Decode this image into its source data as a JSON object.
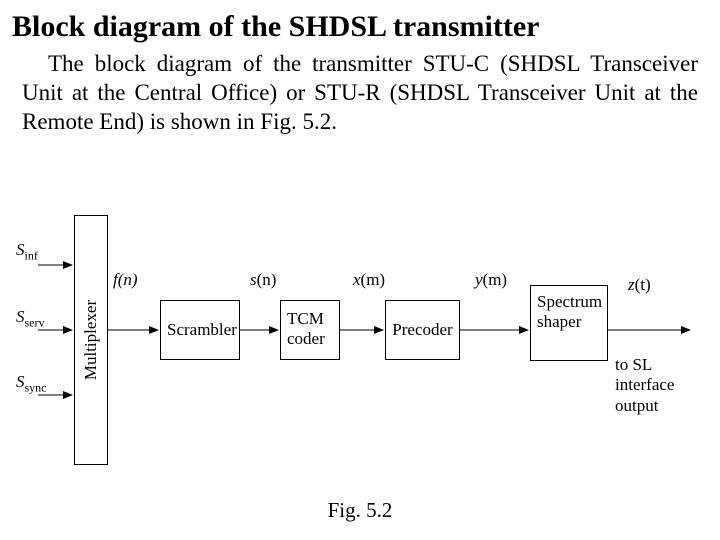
{
  "title": "Block diagram of the SHDSL transmitter",
  "paragraph": "The block diagram of the transmitter STU-C (SHDSL Transceiver Unit at the Central Office) or STU-R (SHDSL Transceiver Unit at the Remote End) is shown in Fig. 5.2.",
  "blocks": {
    "multiplexer": "Multiplexer",
    "scrambler": "Scrambler",
    "tcm_coder": "TCM coder",
    "precoder": "Precoder",
    "spectrum_shaper": "Spectrum shaper"
  },
  "inputs": {
    "s_inf": {
      "base": "S",
      "sub": "inf"
    },
    "s_serv": {
      "base": "S",
      "sub": "serv"
    },
    "s_sync": {
      "base": "S",
      "sub": "sync"
    }
  },
  "signals": {
    "f_n": "f(n)",
    "s_n": {
      "var": "s",
      "arg": "(n)"
    },
    "x_m": {
      "var": "x",
      "arg": "(m)"
    },
    "y_m": {
      "var": "y",
      "arg": "(m)"
    },
    "z_t": {
      "var": "z",
      "arg": "(t)"
    }
  },
  "output_label": "to SL interface output",
  "caption": "Fig. 5.2"
}
